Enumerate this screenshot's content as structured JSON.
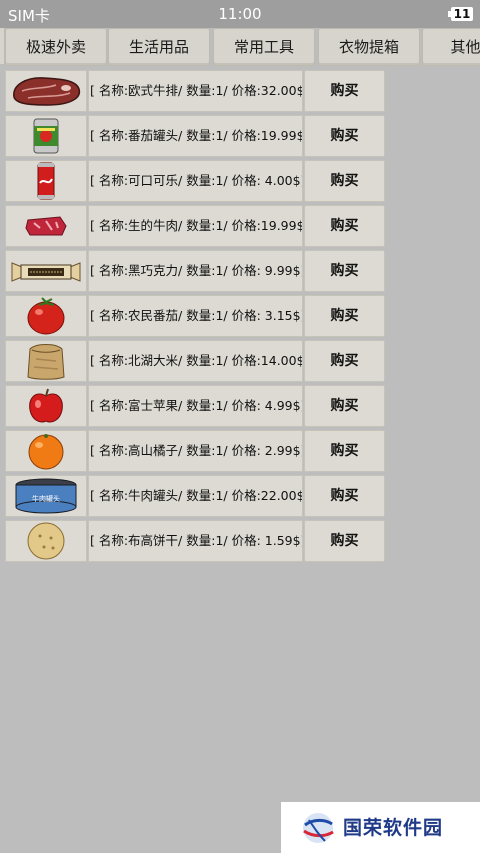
{
  "status": {
    "carrier": "SIM卡",
    "time": "11:00",
    "battery": "11"
  },
  "tabs": [
    "极速外卖",
    "生活用品",
    "常用工具",
    "衣物提箱",
    "其他物"
  ],
  "buy_label": "购买",
  "items": [
    {
      "text": "[ 名称:欧式牛排/ 数量:1/ 价格:32.00$]",
      "icon": "steak-icon"
    },
    {
      "text": "[ 名称:番茄罐头/ 数量:1/ 价格:19.99$]",
      "icon": "tomato-can-icon"
    },
    {
      "text": "[ 名称:可口可乐/ 数量:1/ 价格:  4.00$]",
      "icon": "cola-can-icon"
    },
    {
      "text": "[ 名称:生的牛肉/ 数量:1/ 价格:19.99$]",
      "icon": "raw-beef-icon"
    },
    {
      "text": "[ 名称:黑巧克力/ 数量:1/ 价格:  9.99$]",
      "icon": "chocolate-bar-icon"
    },
    {
      "text": "[ 名称:农民番茄/ 数量:1/ 价格:  3.15$]",
      "icon": "tomato-icon"
    },
    {
      "text": "[ 名称:北湖大米/ 数量:1/ 价格:14.00$]",
      "icon": "rice-sack-icon"
    },
    {
      "text": "[ 名称:富士苹果/ 数量:1/ 价格:  4.99$]",
      "icon": "apple-icon"
    },
    {
      "text": "[ 名称:高山橘子/ 数量:1/ 价格:  2.99$]",
      "icon": "orange-icon"
    },
    {
      "text": "[ 名称:牛肉罐头/ 数量:1/ 价格:22.00$]",
      "icon": "beef-can-icon",
      "label": "牛肉罐头"
    },
    {
      "text": "[ 名称:布高饼干/ 数量:1/ 价格:  1.59$]",
      "icon": "biscuit-icon"
    }
  ],
  "watermark": "国荣软件园"
}
